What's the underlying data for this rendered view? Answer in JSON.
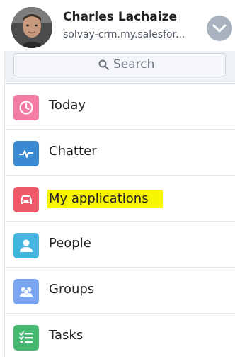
{
  "user": {
    "name": "Charles Lachaize",
    "domain": "solvay-crm.my.salesfor..."
  },
  "header": {
    "toggle_icon": "chevron-down-icon"
  },
  "search": {
    "placeholder": "Search",
    "icon": "search-icon"
  },
  "nav": {
    "items": [
      {
        "label": "Today",
        "icon": "clock-icon",
        "color": "#f27ca3"
      },
      {
        "label": "Chatter",
        "icon": "pulse-icon",
        "color": "#3a8ad1"
      },
      {
        "label": "My applications",
        "icon": "car-icon",
        "color": "#ee5a6a",
        "highlighted": true
      },
      {
        "label": "People",
        "icon": "person-icon",
        "color": "#43b6e0"
      },
      {
        "label": "Groups",
        "icon": "group-icon",
        "color": "#7aa6f1"
      },
      {
        "label": "Tasks",
        "icon": "task-list-icon",
        "color": "#44b771"
      }
    ]
  },
  "colors": {
    "highlight": "#f8f500",
    "toggle_bg": "#a9b3bf",
    "search_band": "#eef1f6"
  }
}
